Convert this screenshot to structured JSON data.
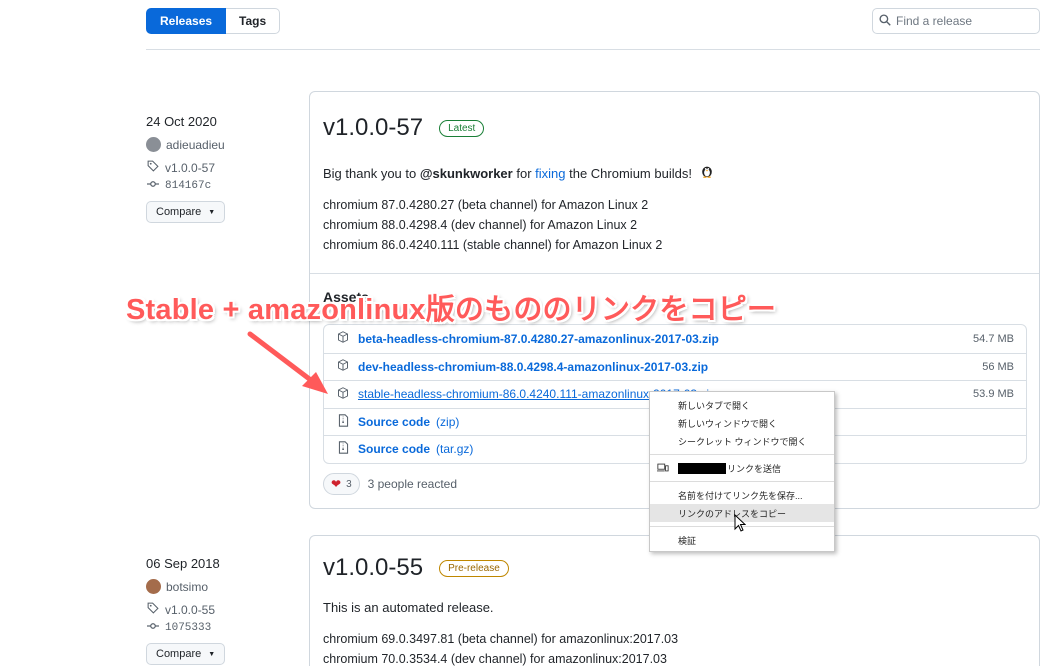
{
  "header": {
    "tabs": [
      {
        "label": "Releases",
        "active": true
      },
      {
        "label": "Tags",
        "active": false
      }
    ],
    "search_placeholder": "Find a release"
  },
  "releases": [
    {
      "date": "24 Oct 2020",
      "author": "adieuadieu",
      "tag": "v1.0.0-57",
      "commit": "814167c",
      "compare_label": "Compare",
      "title": "v1.0.0-57",
      "badge": "Latest",
      "desc_prefix": "Big thank you to ",
      "desc_mention": "@skunkworker",
      "desc_mid": " for ",
      "desc_link": "fixing",
      "desc_suffix": " the Chromium builds!",
      "lines": [
        "chromium 87.0.4280.27 (beta channel) for Amazon Linux 2",
        "chromium 88.0.4298.4 (dev channel) for Amazon Linux 2",
        "chromium 86.0.4240.111 (stable channel) for Amazon Linux 2"
      ],
      "assets_label": "Assets",
      "assets": [
        {
          "name": "beta-headless-chromium-87.0.4280.27-amazonlinux-2017-03.zip",
          "size": "54.7 MB"
        },
        {
          "name": "dev-headless-chromium-88.0.4298.4-amazonlinux-2017-03.zip",
          "size": "56 MB"
        },
        {
          "name": "stable-headless-chromium-86.0.4240.111-amazonlinux-2017-03.zip",
          "size": "53.9 MB"
        },
        {
          "name": "Source code",
          "format": "(zip)"
        },
        {
          "name": "Source code",
          "format": "(tar.gz)"
        }
      ],
      "reaction_count": "3",
      "reaction_text": "3 people reacted"
    },
    {
      "date": "06 Sep 2018",
      "author": "botsimo",
      "tag": "v1.0.0-55",
      "commit": "1075333",
      "compare_label": "Compare",
      "title": "v1.0.0-55",
      "badge": "Pre-release",
      "desc": "This is an automated release.",
      "lines": [
        "chromium 69.0.3497.81 (beta channel) for amazonlinux:2017.03",
        "chromium 70.0.3534.4 (dev channel) for amazonlinux:2017.03"
      ]
    }
  ],
  "annotation": "Stable + amazonlinux版のもののリンクをコピー",
  "context_menu": {
    "items": [
      "新しいタブで開く",
      "新しいウィンドウで開く",
      "シークレット ウィンドウで開く",
      "リンクを送信",
      "名前を付けてリンク先を保存...",
      "リンクのアドレスをコピー",
      "検証"
    ]
  },
  "colors": {
    "accent": "#0969da",
    "annotation": "#ff5a5a",
    "latest": "#1a7f37",
    "prerelease": "#9a6700"
  }
}
